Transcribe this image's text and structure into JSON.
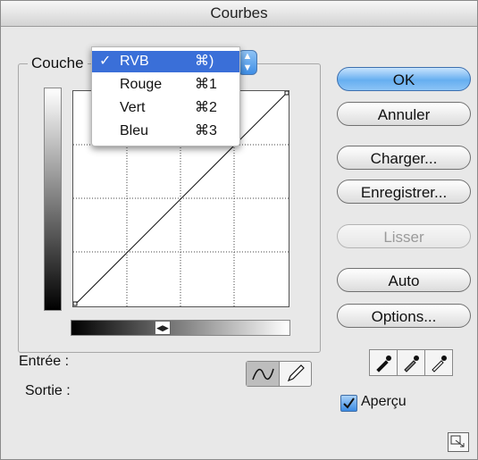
{
  "window": {
    "title": "Courbes"
  },
  "channel": {
    "label": "Couche",
    "menu": [
      {
        "check": "✓",
        "label": "RVB",
        "shortcut": "⌘)"
      },
      {
        "check": "",
        "label": "Rouge",
        "shortcut": "⌘1"
      },
      {
        "check": "",
        "label": "Vert",
        "shortcut": "⌘2"
      },
      {
        "check": "",
        "label": "Bleu",
        "shortcut": "⌘3"
      }
    ],
    "selected_index": 0
  },
  "fields": {
    "input_label": "Entrée :",
    "output_label": "Sortie :"
  },
  "buttons": {
    "ok": "OK",
    "cancel": "Annuler",
    "load": "Charger...",
    "save": "Enregistrer...",
    "smooth": "Lisser",
    "auto": "Auto",
    "options": "Options..."
  },
  "preview": {
    "label": "Aperçu",
    "checked": true
  },
  "icons": {
    "curve_tool": "curve-icon",
    "pencil_tool": "pencil-icon",
    "black_point": "eyedropper-black-icon",
    "gray_point": "eyedropper-gray-icon",
    "white_point": "eyedropper-white-icon",
    "gradient_toggle": "gradient-toggle-icon",
    "resize": "resize-icon"
  },
  "colors": {
    "accent": "#3a6fd8",
    "default_button": "#66aef0"
  }
}
